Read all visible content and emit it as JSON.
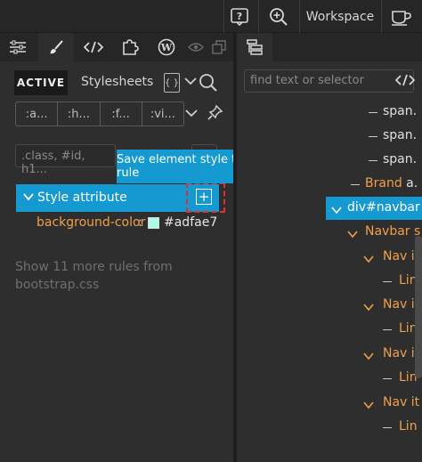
{
  "topbar": {
    "help_icon": "help-icon",
    "zoom_icon": "zoom-in-icon",
    "workspace_label": "Workspace",
    "cup_icon": "coffee-cup-icon"
  },
  "left_tabs": [
    {
      "icon": "sliders-icon"
    },
    {
      "icon": "brush-icon"
    },
    {
      "icon": "code-icon"
    },
    {
      "icon": "puzzle-icon"
    },
    {
      "icon": "wordpress-icon"
    },
    {
      "icon": "eye-icon"
    },
    {
      "icon": "windows-icon"
    }
  ],
  "styles": {
    "active_label": "ACTIVE",
    "stylesheets_label": "Stylesheets",
    "file_glyph": "{ }",
    "pseudo": [
      ":a...",
      ":h...",
      ":f...",
      ":vi..."
    ],
    "selector_placeholder": ".class, #id, h1...",
    "tooltip": "Save element style to CSS rule",
    "rule_title": "Style attribute",
    "decl_prop": "background-color",
    "decl_colon": ":",
    "decl_value": "#adfae7",
    "decl_swatch_color": "#adfae7",
    "more_rules": "Show 11 more rules from bootstrap.css"
  },
  "tree": {
    "find_placeholder": "find text or selector",
    "items": [
      {
        "label": "span.",
        "color": "white"
      },
      {
        "label": "span.",
        "color": "white"
      },
      {
        "label": "span.",
        "color": "white"
      },
      {
        "label": "Brand",
        "suffix": " a.",
        "color": "orange"
      },
      {
        "label": "div#navbar",
        "color": "selected"
      },
      {
        "label": "Navbar s",
        "color": "orange"
      },
      {
        "label": "Nav it",
        "color": "orange"
      },
      {
        "label": "Lin",
        "color": "orange"
      },
      {
        "label": "Nav it",
        "color": "orange"
      },
      {
        "label": "Lin",
        "color": "orange"
      },
      {
        "label": "Nav it",
        "color": "orange"
      },
      {
        "label": "Lin",
        "color": "orange"
      },
      {
        "label": "Nav it",
        "color": "orange"
      },
      {
        "label": "Lin",
        "color": "orange"
      }
    ]
  }
}
